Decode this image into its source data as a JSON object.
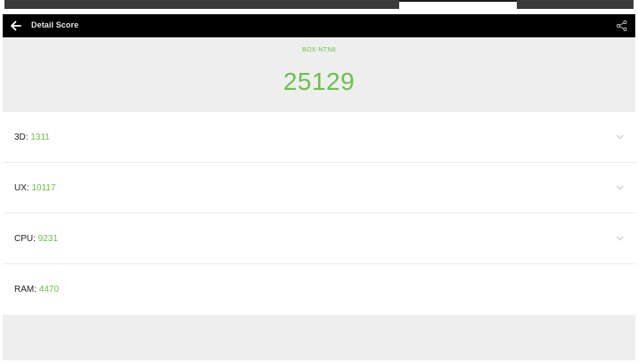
{
  "appbar": {
    "title": "Detail Score",
    "back_icon": "arrow-left-icon",
    "share_icon": "share-icon"
  },
  "summary": {
    "device": "BOX-NTN8",
    "total_score": "25129"
  },
  "scores": [
    {
      "label": "3D: ",
      "value": "1311",
      "expandable": true
    },
    {
      "label": "UX: ",
      "value": "10117",
      "expandable": true
    },
    {
      "label": "CPU: ",
      "value": "9231",
      "expandable": true
    },
    {
      "label": "RAM: ",
      "value": "4470",
      "expandable": false
    }
  ],
  "colors": {
    "accent": "#6cc04a",
    "appbar": "#000000",
    "panel": "#eeeeee"
  }
}
